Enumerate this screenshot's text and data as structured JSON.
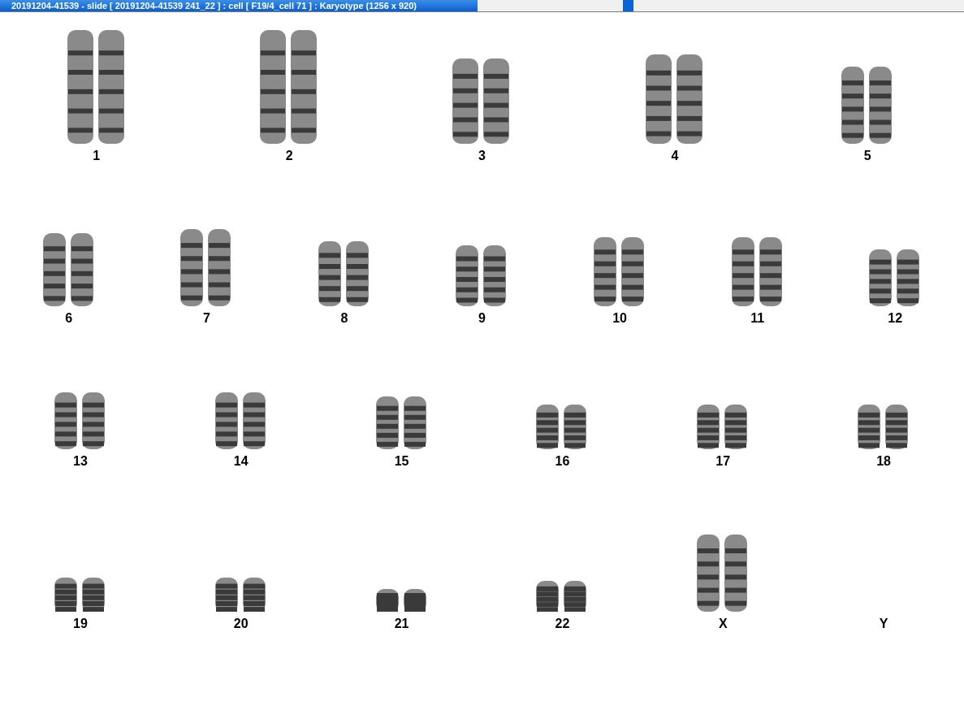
{
  "window": {
    "title": "20191204-41539 - slide [ 20191204-41539 241_22 ] : cell [ F19/4_cell 71 ] : Karyotype  (1256 x 920)"
  },
  "karyotype": {
    "rows": [
      {
        "pairs": [
          {
            "label": "1",
            "kind": "pair"
          },
          {
            "label": "2",
            "kind": "pair"
          },
          {
            "label": "3",
            "kind": "pair"
          },
          {
            "label": "4",
            "kind": "pair"
          },
          {
            "label": "5",
            "kind": "pair"
          }
        ]
      },
      {
        "pairs": [
          {
            "label": "6",
            "kind": "pair"
          },
          {
            "label": "7",
            "kind": "pair"
          },
          {
            "label": "8",
            "kind": "pair"
          },
          {
            "label": "9",
            "kind": "pair"
          },
          {
            "label": "10",
            "kind": "pair"
          },
          {
            "label": "11",
            "kind": "pair"
          },
          {
            "label": "12",
            "kind": "pair"
          }
        ]
      },
      {
        "pairs": [
          {
            "label": "13",
            "kind": "pair"
          },
          {
            "label": "14",
            "kind": "pair"
          },
          {
            "label": "15",
            "kind": "pair"
          },
          {
            "label": "16",
            "kind": "pair"
          },
          {
            "label": "17",
            "kind": "pair"
          },
          {
            "label": "18",
            "kind": "pair"
          }
        ]
      },
      {
        "pairs": [
          {
            "label": "19",
            "kind": "pair"
          },
          {
            "label": "20",
            "kind": "pair"
          },
          {
            "label": "21",
            "kind": "pair"
          },
          {
            "label": "22",
            "kind": "pair"
          },
          {
            "label": "X",
            "kind": "pair"
          },
          {
            "label": "Y",
            "kind": "empty"
          }
        ]
      }
    ]
  }
}
